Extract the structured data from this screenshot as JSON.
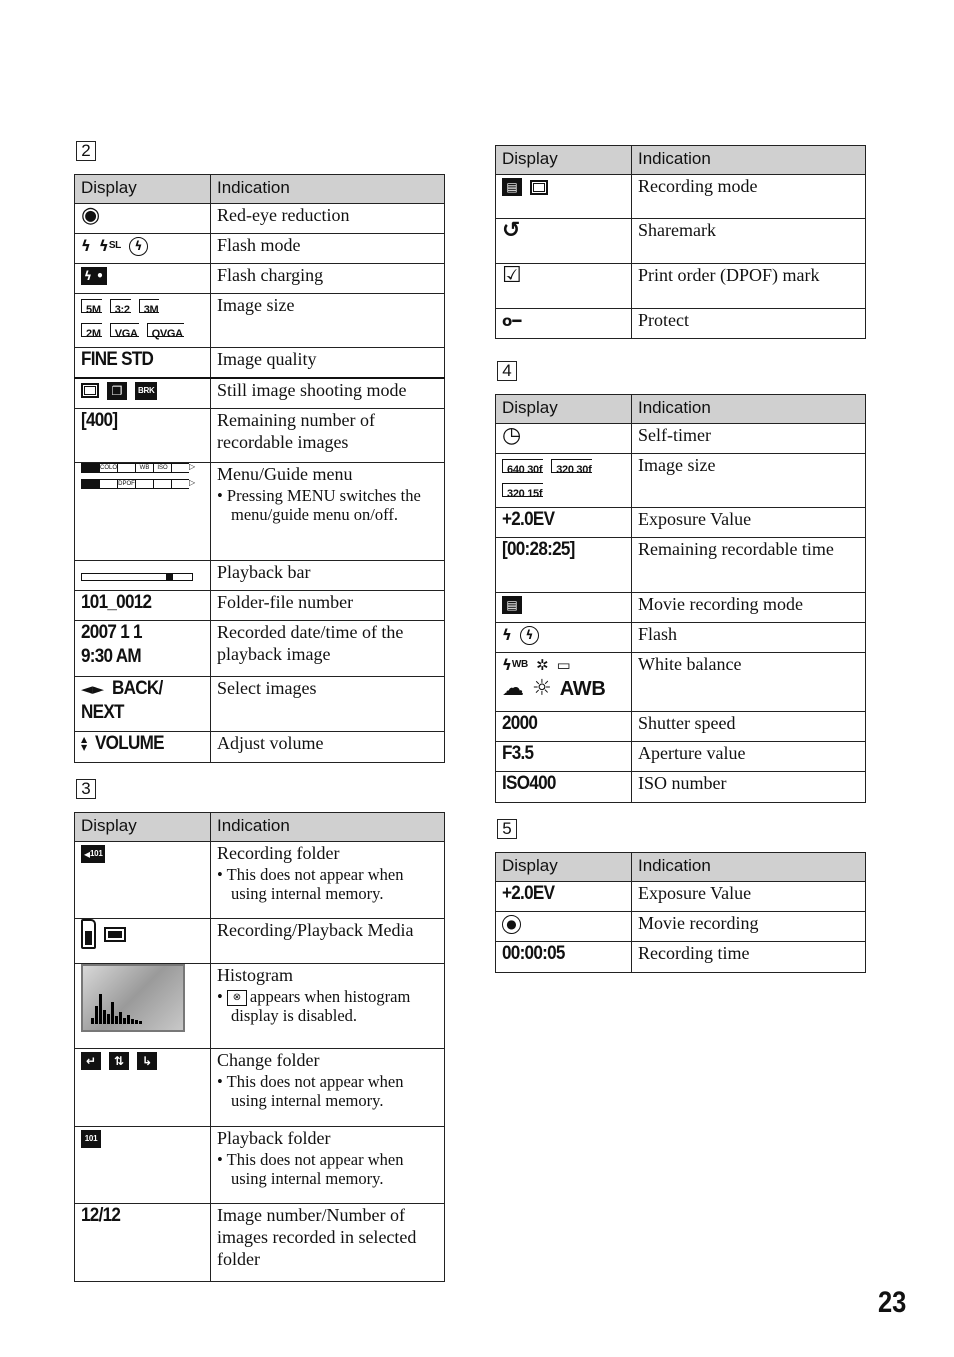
{
  "page_number": "23",
  "header": {
    "display": "Display",
    "indication": "Indication"
  },
  "tables": [
    {
      "label": "2",
      "rows": [
        {
          "display": [
            [
              {
                "icon": "red-eye-icon"
              }
            ]
          ],
          "indication": "Red-eye reduction"
        },
        {
          "display": [
            [
              {
                "icon": "flash-icon"
              },
              {
                "icon": "flash-slow-sync-icon",
                "label": "SL"
              },
              {
                "icon": "flash-off-icon"
              }
            ]
          ],
          "indication": "Flash mode"
        },
        {
          "display": [
            [
              {
                "icon": "flash-charging-icon"
              }
            ]
          ],
          "indication": "Flash charging"
        },
        {
          "display": [
            [
              {
                "icon": "image-size-icon",
                "label": "5M"
              },
              {
                "icon": "image-size-icon",
                "label": "3:2"
              },
              {
                "icon": "image-size-icon",
                "label": "3M"
              }
            ],
            [
              {
                "icon": "image-size-icon",
                "label": "2M"
              },
              {
                "icon": "image-size-icon",
                "label": "VGA"
              },
              {
                "icon": "image-size-icon",
                "label": "QVGA"
              }
            ]
          ],
          "indication": "Image size"
        },
        {
          "display": [
            [
              {
                "text": "FINE STD"
              }
            ]
          ],
          "indication": "Image quality"
        },
        {
          "display": [
            [
              {
                "icon": "single-shot-icon"
              },
              {
                "icon": "burst-icon"
              },
              {
                "icon": "bracket-icon",
                "label": "BRK"
              }
            ]
          ],
          "indication": "Still image shooting mode",
          "thick": true
        },
        {
          "display": [
            [
              {
                "text": "[400]"
              }
            ]
          ],
          "indication": "Remaining number of recordable images"
        },
        {
          "display": [
            [
              {
                "icon": "menu-bar-icon",
                "items": [
                  [
                    "",
                    "COLOR",
                    "",
                    "WB",
                    "ISO",
                    ""
                  ],
                  [
                    "",
                    "",
                    "DPOF",
                    "",
                    "",
                    ""
                  ]
                ]
              }
            ]
          ],
          "indication": "Menu/Guide menu",
          "bullet": "Pressing MENU switches the menu/guide menu on/off."
        },
        {
          "display": [
            [
              {
                "icon": "playback-bar-icon",
                "value": 0.8
              }
            ]
          ],
          "indication": "Playback bar"
        },
        {
          "display": [
            [
              {
                "text": "101_0012"
              }
            ]
          ],
          "indication": "Folder-file number"
        },
        {
          "display": [
            [
              {
                "text": "2007 1 1"
              }
            ],
            [
              {
                "text": "9:30 AM"
              }
            ]
          ],
          "indication": "Recorded date/time of the playback image"
        },
        {
          "display": [
            [
              {
                "icon": "arrow-left-right-icon"
              },
              {
                "text": "BACK/"
              }
            ],
            [
              {
                "text": "NEXT"
              }
            ]
          ],
          "indication": "Select images"
        },
        {
          "display": [
            [
              {
                "icon": "up-down-icon"
              },
              {
                "text": "VOLUME"
              }
            ]
          ],
          "indication": "Adjust volume"
        }
      ]
    },
    {
      "label": "3",
      "rows": [
        {
          "display": [
            [
              {
                "icon": "recording-folder-icon",
                "label": "101"
              }
            ]
          ],
          "indication": "Recording folder",
          "bullet": "This does not appear when using internal memory."
        },
        {
          "display": [
            [
              {
                "icon": "memory-stick-icon"
              },
              {
                "icon": "internal-memory-icon"
              }
            ]
          ],
          "indication": "Recording/Playback Media"
        },
        {
          "display": [
            [
              {
                "icon": "histogram-icon"
              }
            ]
          ],
          "indication": "Histogram",
          "bullet": "appears when histogram display is disabled.",
          "bullet_icon": "histogram-off-icon"
        },
        {
          "display": [
            [
              {
                "icon": "change-folder-back-icon"
              },
              {
                "icon": "change-folder-both-icon"
              },
              {
                "icon": "change-folder-next-icon"
              }
            ]
          ],
          "indication": "Change folder",
          "bullet": "This does not appear when using internal memory."
        },
        {
          "display": [
            [
              {
                "icon": "playback-folder-icon",
                "label": "101"
              }
            ]
          ],
          "indication": "Playback folder",
          "bullet": "This does not appear when using internal memory."
        },
        {
          "display": [
            [
              {
                "text": "12/12"
              }
            ]
          ],
          "indication": "Image number/Number of images recorded in selected folder"
        }
      ]
    },
    {
      "label": "",
      "rows": [
        {
          "display": [
            [
              {
                "icon": "movie-mode-icon"
              },
              {
                "icon": "still-mode-icon"
              }
            ]
          ],
          "indication": "Recording mode"
        },
        {
          "display": [
            [
              {
                "icon": "sharemark-icon"
              }
            ]
          ],
          "indication": "Sharemark"
        },
        {
          "display": [
            [
              {
                "icon": "print-order-icon"
              }
            ]
          ],
          "indication": "Print order (DPOF) mark"
        },
        {
          "display": [
            [
              {
                "icon": "protect-icon"
              }
            ]
          ],
          "indication": "Protect"
        }
      ]
    },
    {
      "label": "4",
      "rows": [
        {
          "display": [
            [
              {
                "icon": "self-timer-icon"
              }
            ]
          ],
          "indication": "Self-timer"
        },
        {
          "display": [
            [
              {
                "icon": "movie-size-icon",
                "label": "640 30f"
              },
              {
                "icon": "movie-size-icon",
                "label": "320 30f"
              }
            ],
            [
              {
                "icon": "movie-size-icon",
                "label": "320 15f"
              }
            ]
          ],
          "indication": "Image size"
        },
        {
          "display": [
            [
              {
                "text": "+2.0EV"
              }
            ]
          ],
          "indication": "Exposure Value"
        },
        {
          "display": [
            [
              {
                "text": "[00:28:25]"
              }
            ]
          ],
          "indication": "Remaining recordable time"
        },
        {
          "display": [
            [
              {
                "icon": "movie-mode-icon"
              }
            ]
          ],
          "indication": "Movie recording mode"
        },
        {
          "display": [
            [
              {
                "icon": "flash-icon"
              },
              {
                "icon": "flash-off-icon"
              }
            ]
          ],
          "indication": "Flash"
        },
        {
          "display": [
            [
              {
                "icon": "wb-flash-icon",
                "label": "WB"
              },
              {
                "icon": "wb-incandescent-icon"
              },
              {
                "icon": "wb-fluorescent-icon"
              }
            ],
            [
              {
                "icon": "wb-cloudy-icon"
              },
              {
                "icon": "wb-daylight-icon"
              },
              {
                "icon": "wb-auto-icon",
                "label": "AWB"
              }
            ]
          ],
          "indication": "White balance"
        },
        {
          "display": [
            [
              {
                "text": "2000"
              }
            ]
          ],
          "indication": "Shutter speed"
        },
        {
          "display": [
            [
              {
                "text": "F3.5"
              }
            ]
          ],
          "indication": "Aperture value"
        },
        {
          "display": [
            [
              {
                "text": "ISO400"
              }
            ]
          ],
          "indication": "ISO number"
        }
      ]
    },
    {
      "label": "5",
      "rows": [
        {
          "display": [
            [
              {
                "text": "+2.0EV"
              }
            ]
          ],
          "indication": "Exposure Value"
        },
        {
          "display": [
            [
              {
                "icon": "movie-recording-icon"
              }
            ]
          ],
          "indication": "Movie recording"
        },
        {
          "display": [
            [
              {
                "text": "00:00:05"
              }
            ]
          ],
          "indication": "Recording time"
        }
      ]
    }
  ]
}
